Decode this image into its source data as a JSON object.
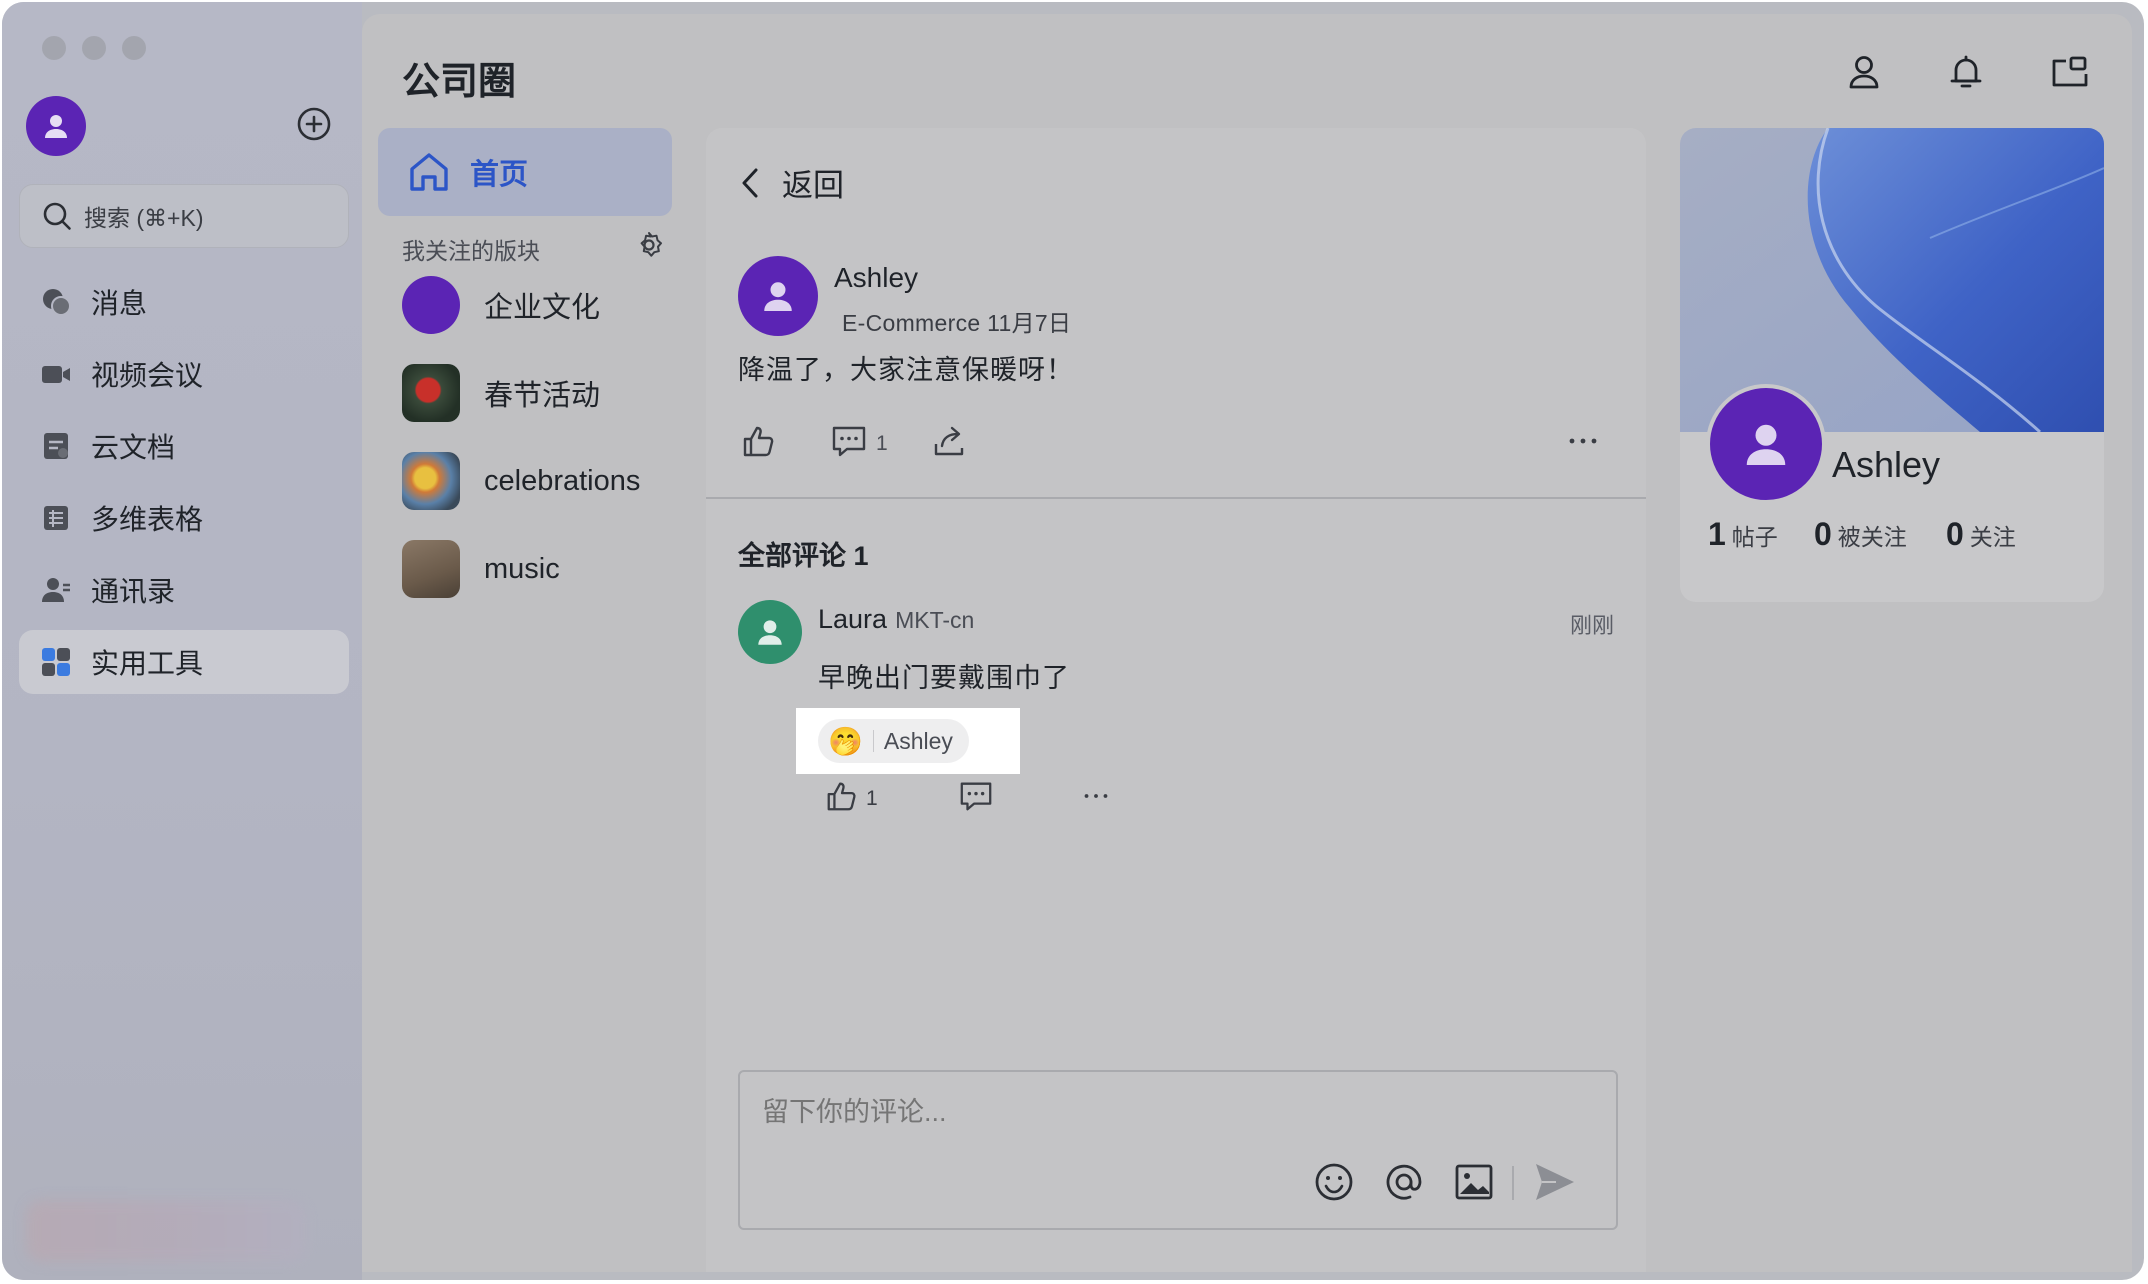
{
  "sidebar": {
    "search_placeholder": "搜索 (⌘+K)",
    "items": [
      {
        "label": "消息",
        "icon": "chat-icon"
      },
      {
        "label": "视频会议",
        "icon": "video-icon"
      },
      {
        "label": "云文档",
        "icon": "document-icon"
      },
      {
        "label": "多维表格",
        "icon": "table-icon"
      },
      {
        "label": "通讯录",
        "icon": "contacts-icon"
      },
      {
        "label": "实用工具",
        "icon": "tools-icon",
        "active": true
      }
    ]
  },
  "main": {
    "title": "公司圈"
  },
  "sections": {
    "home_label": "首页",
    "followed_heading": "我关注的版块",
    "items": [
      {
        "label": "企业文化"
      },
      {
        "label": "春节活动"
      },
      {
        "label": "celebrations"
      },
      {
        "label": "music"
      }
    ]
  },
  "post": {
    "back_label": "返回",
    "author": "Ashley",
    "meta": "E-Commerce 11月7日",
    "body": "降温了，大家注意保暖呀！",
    "comment_count": "1",
    "comments_heading": "全部评论 1"
  },
  "comment": {
    "author": "Laura",
    "dept": "MKT-cn",
    "time": "刚刚",
    "text": "早晚出门要戴围巾了",
    "reaction_user": "Ashley",
    "reaction_emoji": "🤭",
    "like_count": "1"
  },
  "composer": {
    "placeholder": "留下你的评论..."
  },
  "profile": {
    "name": "Ashley",
    "posts_count": "1",
    "posts_label": "帖子",
    "followers_count": "0",
    "followers_label": "被关注",
    "following_count": "0",
    "following_label": "关注"
  },
  "colors": {
    "accent": "#2c55c7",
    "avatar_purple": "#5b24b4",
    "avatar_green": "#2f8f6d"
  }
}
